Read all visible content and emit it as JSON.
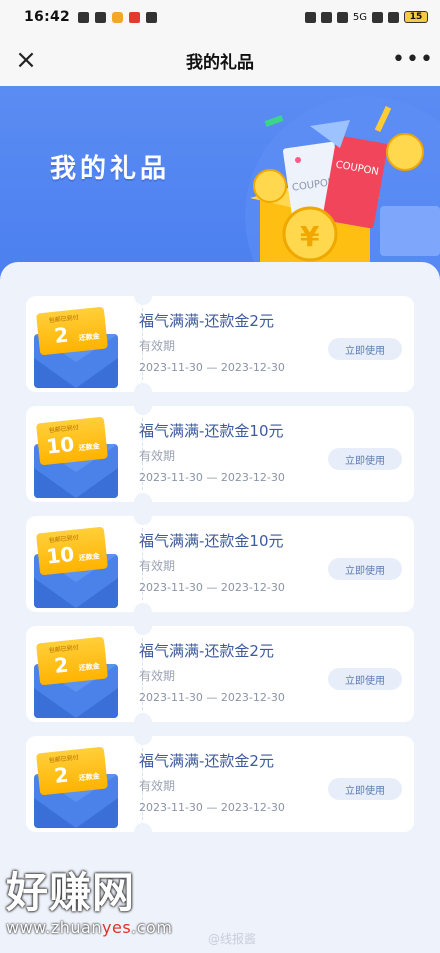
{
  "status_bar": {
    "time": "16:42",
    "network": "5G",
    "battery": "15"
  },
  "nav": {
    "close_icon": "×",
    "title": "我的礼品",
    "more_icon": "•••"
  },
  "banner": {
    "title": "我的礼品",
    "coupon_text_1": "COUPON",
    "coupon_text_2": "COUPON",
    "yen": "¥",
    "colors": {
      "sky": "#4b7ff0",
      "gold": "#ffc21a",
      "red": "#f0455a"
    }
  },
  "coupons": [
    {
      "title": "福气满满-还款金2元",
      "validity_label": "有效期",
      "dates": "2023-11-30 — 2023-12-30",
      "button": "立即使用",
      "ticket_top": "包邮已到付",
      "amount": "2",
      "unit": "还款金"
    },
    {
      "title": "福气满满-还款金10元",
      "validity_label": "有效期",
      "dates": "2023-11-30 — 2023-12-30",
      "button": "立即使用",
      "ticket_top": "包邮已到付",
      "amount": "10",
      "unit": "还款金"
    },
    {
      "title": "福气满满-还款金10元",
      "validity_label": "有效期",
      "dates": "2023-11-30 — 2023-12-30",
      "button": "立即使用",
      "ticket_top": "包邮已到付",
      "amount": "10",
      "unit": "还款金"
    },
    {
      "title": "福气满满-还款金2元",
      "validity_label": "有效期",
      "dates": "2023-11-30 — 2023-12-30",
      "button": "立即使用",
      "ticket_top": "包邮已到付",
      "amount": "2",
      "unit": "还款金"
    },
    {
      "title": "福气满满-还款金2元",
      "validity_label": "有效期",
      "dates": "2023-11-30 — 2023-12-30",
      "button": "立即使用",
      "ticket_top": "包邮已到付",
      "amount": "2",
      "unit": "还款金"
    }
  ],
  "watermark": {
    "big": "好赚网",
    "url_prefix": "www.zhuan",
    "url_highlight": "yes",
    "url_suffix": ".com",
    "credit": "@线报酱"
  }
}
